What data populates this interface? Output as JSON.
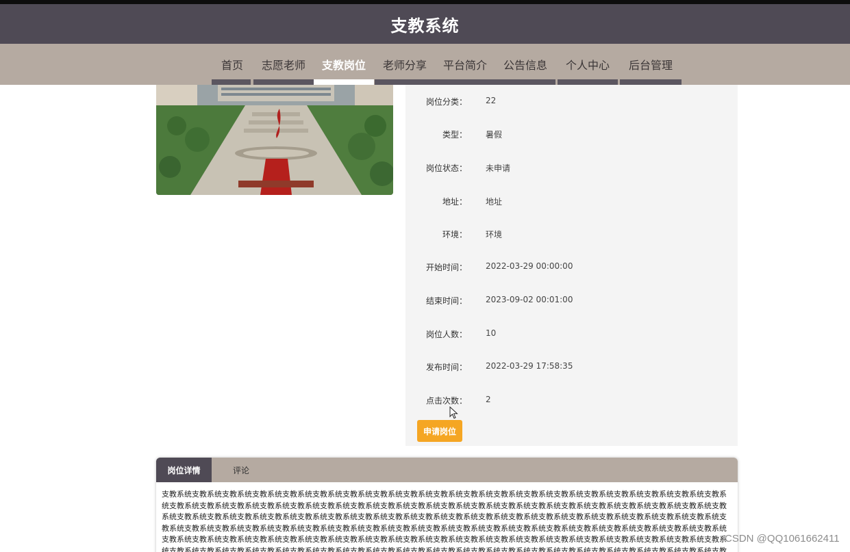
{
  "header": {
    "title": "支教系统"
  },
  "nav": {
    "items": [
      {
        "label": "首页"
      },
      {
        "label": "志愿老师"
      },
      {
        "label": "支教岗位"
      },
      {
        "label": "老师分享"
      },
      {
        "label": "平台简介"
      },
      {
        "label": "公告信息"
      },
      {
        "label": "个人中心"
      },
      {
        "label": "后台管理"
      }
    ],
    "active": "支教岗位"
  },
  "details": [
    {
      "label": "岗位分类：",
      "value": "22"
    },
    {
      "label": "类型：",
      "value": "暑假"
    },
    {
      "label": "岗位状态：",
      "value": "未申请"
    },
    {
      "label": "地址：",
      "value": "地址"
    },
    {
      "label": "环境：",
      "value": "环境"
    },
    {
      "label": "开始时间：",
      "value": "2022-03-29 00:00:00"
    },
    {
      "label": "结束时间：",
      "value": "2023-09-02 00:01:00"
    },
    {
      "label": "岗位人数：",
      "value": "10"
    },
    {
      "label": "发布时间：",
      "value": "2022-03-29 17:58:35"
    },
    {
      "label": "点击次数：",
      "value": "2"
    }
  ],
  "apply_button": "申请岗位",
  "tabs": [
    {
      "label": "岗位详情"
    },
    {
      "label": "评论"
    }
  ],
  "detail_text": "支教系统支教系统支教系统支教系统支教系统支教系统支教系统支教系统支教系统支教系统支教系统支教系统支教系统支教系统支教系统支教系统支教系统支教系统支教系统支教系统支教系统支教系统支教系统支教系统支教系统支教系统支教系统支教系统支教系统支教系统支教系统支教系统支教系统支教系统支教系统支教系统支教系统支教系统支教系统支教系统支教系统支教系统支教系统支教系统支教系统支教系统支教系统支教系统支教系统支教系统支教系统支教系统支教系统支教系统支教系统支教系统支教系统支教系统支教系统支教系统支教系统支教系统支教系统支教系统支教系统支教系统支教系统支教系统支教系统支教系统支教系统支教系统支教系统支教系统支教系统支教系统支教系统支教系统支教系统支教系统支教系统支教系统支教系统支教系统支教系统支教系统支教系统支教系统支教系统支教系统支教系统支教系统支教系统支教系统支教系统支教系统支教系统支教系统支教系统支教系统支教系统支教系统支教系统支教系统支教系统支教系统支教系统支教系统支教系统支教系统支教系统支教系统支教系统支教系统支教系统支教系统支教系统支教系统支教系统支教系统支教系统支教系统支教系统支教系统支教系统支教系统支教系统支教系统",
  "watermark": "CSDN @QQ1061662411"
}
